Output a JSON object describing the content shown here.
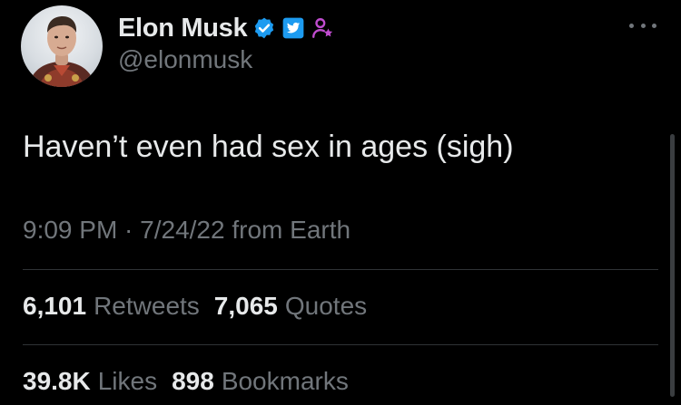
{
  "author": {
    "display_name": "Elon Musk",
    "handle": "@elonmusk",
    "badges": [
      "verified-badge-icon",
      "twitter-affiliate-icon",
      "user-star-icon"
    ],
    "colors": {
      "verified": "#1d9bf0",
      "affiliate": "#1d9bf0",
      "user_star": "#c04ccf"
    }
  },
  "tweet": {
    "text": "Haven’t even had sex in ages (sigh)",
    "meta": "9:09 PM · 7/24/22 from Earth"
  },
  "stats": {
    "retweets": {
      "count": "6,101",
      "label": "Retweets"
    },
    "quotes": {
      "count": "7,065",
      "label": "Quotes"
    },
    "likes": {
      "count": "39.8K",
      "label": "Likes"
    },
    "bookmarks": {
      "count": "898",
      "label": "Bookmarks"
    }
  },
  "icons": {
    "more": "more-options-icon"
  },
  "theme": {
    "background": "#000000",
    "text": "#e7e9ea",
    "muted": "#71767b",
    "divider": "#2f3336"
  }
}
